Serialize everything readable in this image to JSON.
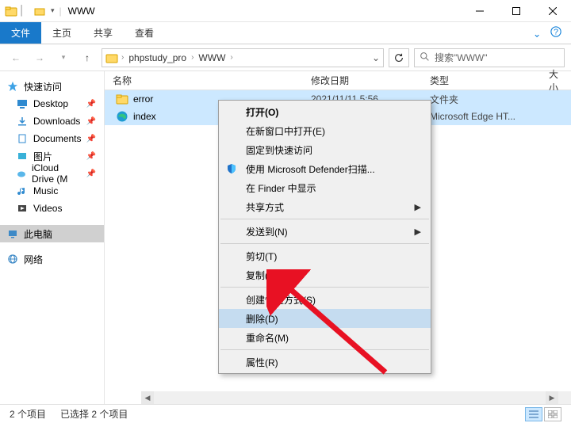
{
  "window": {
    "title": "WWW"
  },
  "ribbon": {
    "file": "文件",
    "home": "主页",
    "share": "共享",
    "view": "查看"
  },
  "address": {
    "crumb1": "phpstudy_pro",
    "crumb2": "WWW"
  },
  "search": {
    "placeholder": "搜索\"WWW\""
  },
  "sidebar": {
    "quick": "快速访问",
    "items": [
      {
        "label": "Desktop"
      },
      {
        "label": "Downloads"
      },
      {
        "label": "Documents"
      },
      {
        "label": "图片"
      },
      {
        "label": "iCloud Drive (M"
      },
      {
        "label": "Music"
      },
      {
        "label": "Videos"
      }
    ],
    "thispc": "此电脑",
    "network": "网络"
  },
  "columns": {
    "name": "名称",
    "date": "修改日期",
    "type": "类型",
    "size": "大小"
  },
  "files": [
    {
      "name": "error",
      "date": "2021/11/11 5:56",
      "type": "文件夹"
    },
    {
      "name": "index",
      "date": "",
      "type": "Microsoft Edge HT..."
    }
  ],
  "ctx": {
    "open": "打开(O)",
    "newwin": "在新窗口中打开(E)",
    "pin": "固定到快速访问",
    "defender": "使用 Microsoft Defender扫描...",
    "finder": "在 Finder 中显示",
    "share": "共享方式",
    "sendto": "发送到(N)",
    "cut": "剪切(T)",
    "copy": "复制(C)",
    "shortcut": "创建快捷方式(S)",
    "delete": "删除(D)",
    "rename": "重命名(M)",
    "props": "属性(R)"
  },
  "status": {
    "count": "2 个项目",
    "selected": "已选择 2 个项目"
  }
}
